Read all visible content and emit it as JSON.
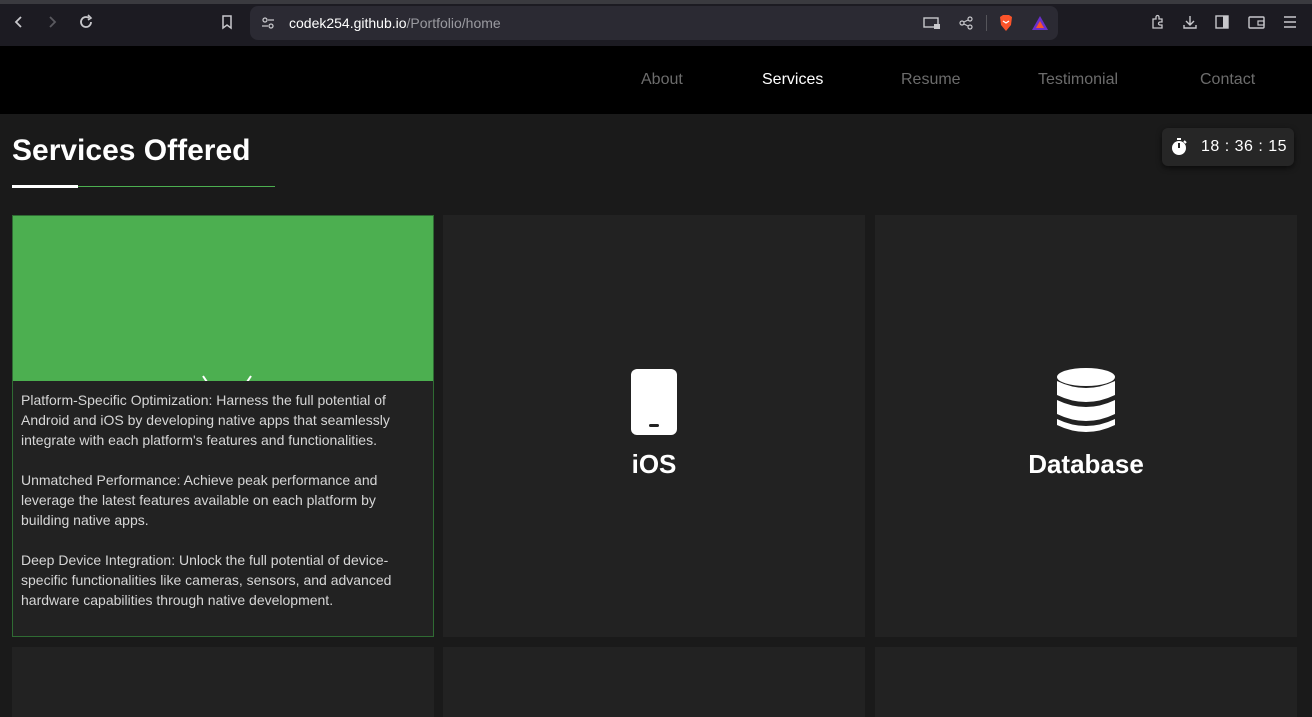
{
  "browser": {
    "url_host": "codek254.github.io",
    "url_path": "/Portfolio/home"
  },
  "nav": {
    "items": [
      {
        "label": "About",
        "active": false
      },
      {
        "label": "Services",
        "active": true
      },
      {
        "label": "Resume",
        "active": false
      },
      {
        "label": "Testimonial",
        "active": false
      },
      {
        "label": "Contact",
        "active": false
      }
    ]
  },
  "section": {
    "title": "Services Offered"
  },
  "timer": {
    "time": "18 : 36 : 15"
  },
  "cards": [
    {
      "label": "",
      "paragraphs": [
        "Platform-Specific Optimization: Harness the full potential of Android and iOS by developing native apps that seamlessly integrate with each platform's features and functionalities.",
        "Unmatched Performance: Achieve peak performance and leverage the latest features available on each platform by building native apps.",
        "Deep Device Integration: Unlock the full potential of device-specific functionalities like cameras, sensors, and advanced hardware capabilities through native development."
      ]
    },
    {
      "label": "iOS",
      "icon": "mobile-phone-icon"
    },
    {
      "label": "Database",
      "icon": "database-icon"
    }
  ],
  "colors": {
    "accent": "#4caf50",
    "card_bg": "#222222",
    "page_bg": "#1a1a1a",
    "nav_bg": "#000000"
  }
}
